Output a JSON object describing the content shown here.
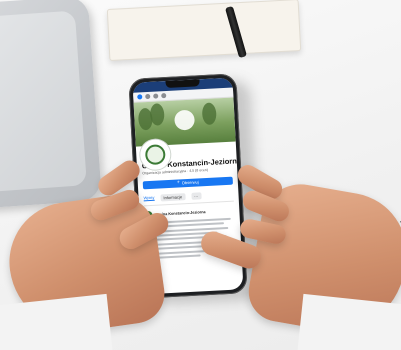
{
  "phone": {
    "page_title": "Gmina Konstancin-Jeziorna",
    "page_subtitle": "Organizacja administracyjna · 4,5 (8 ocen)",
    "follow_button": "Obserwuj",
    "tabs": {
      "posts": "Wpisy",
      "about": "Informacje"
    },
    "post_author": "Gmina Konstancin-Jeziorna"
  }
}
